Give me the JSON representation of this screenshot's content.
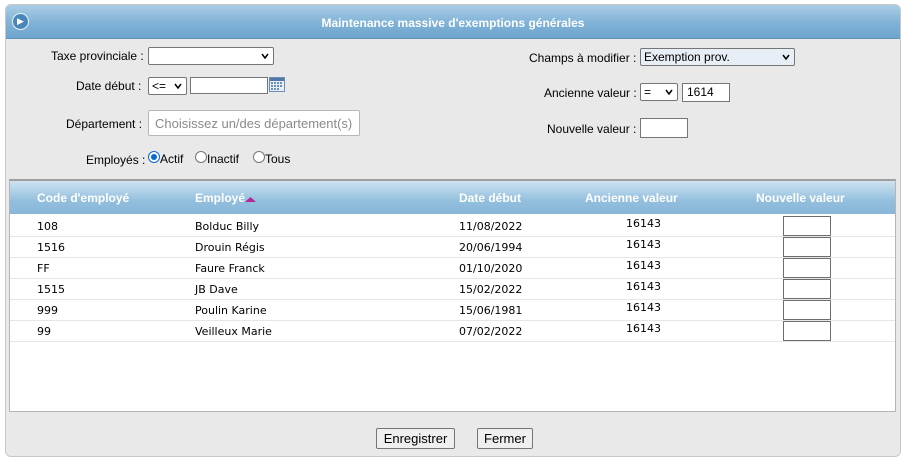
{
  "window": {
    "title": "Maintenance massive d'exemptions générales"
  },
  "filters": {
    "taxe_label": "Taxe provinciale :",
    "taxe_value": "",
    "date_debut_label": "Date début :",
    "date_operator": "<=",
    "date_value": "",
    "departement_label": "Département :",
    "departement_placeholder": "Choisissez un/des département(s)",
    "employes_label": "Employés :",
    "employes_options": [
      "Actif",
      "Inactif",
      "Tous"
    ],
    "employes_selected": "Actif",
    "champs_label": "Champs à modifier :",
    "champs_value": "Exemption prov.",
    "ancienne_label": "Ancienne valeur :",
    "ancienne_operator": "=",
    "ancienne_value": "1614",
    "nouvelle_label": "Nouvelle valeur :",
    "nouvelle_value": ""
  },
  "table": {
    "columns": [
      "Code d'employé",
      "Employé",
      "Date début",
      "Ancienne valeur",
      "Nouvelle valeur"
    ],
    "sort_column": "Employé",
    "rows": [
      {
        "code": "108",
        "employe": "Bolduc Billy",
        "date": "11/08/2022",
        "ancienne": "16143",
        "nouvelle": ""
      },
      {
        "code": "1516",
        "employe": "Drouin Régis",
        "date": "20/06/1994",
        "ancienne": "16143",
        "nouvelle": ""
      },
      {
        "code": "FF",
        "employe": "Faure Franck",
        "date": "01/10/2020",
        "ancienne": "16143",
        "nouvelle": ""
      },
      {
        "code": "1515",
        "employe": "JB Dave",
        "date": "15/02/2022",
        "ancienne": "16143",
        "nouvelle": ""
      },
      {
        "code": "999",
        "employe": "Poulin Karine",
        "date": "15/06/1981",
        "ancienne": "16143",
        "nouvelle": ""
      },
      {
        "code": "99",
        "employe": "Veilleux Marie",
        "date": "07/02/2022",
        "ancienne": "16143",
        "nouvelle": ""
      }
    ]
  },
  "footer": {
    "save_label": "Enregistrer",
    "close_label": "Fermer"
  },
  "colors": {
    "header_blue": "#88b6d8",
    "title_blue": "#7fb2d6",
    "radio_blue": "#0b66d6"
  }
}
